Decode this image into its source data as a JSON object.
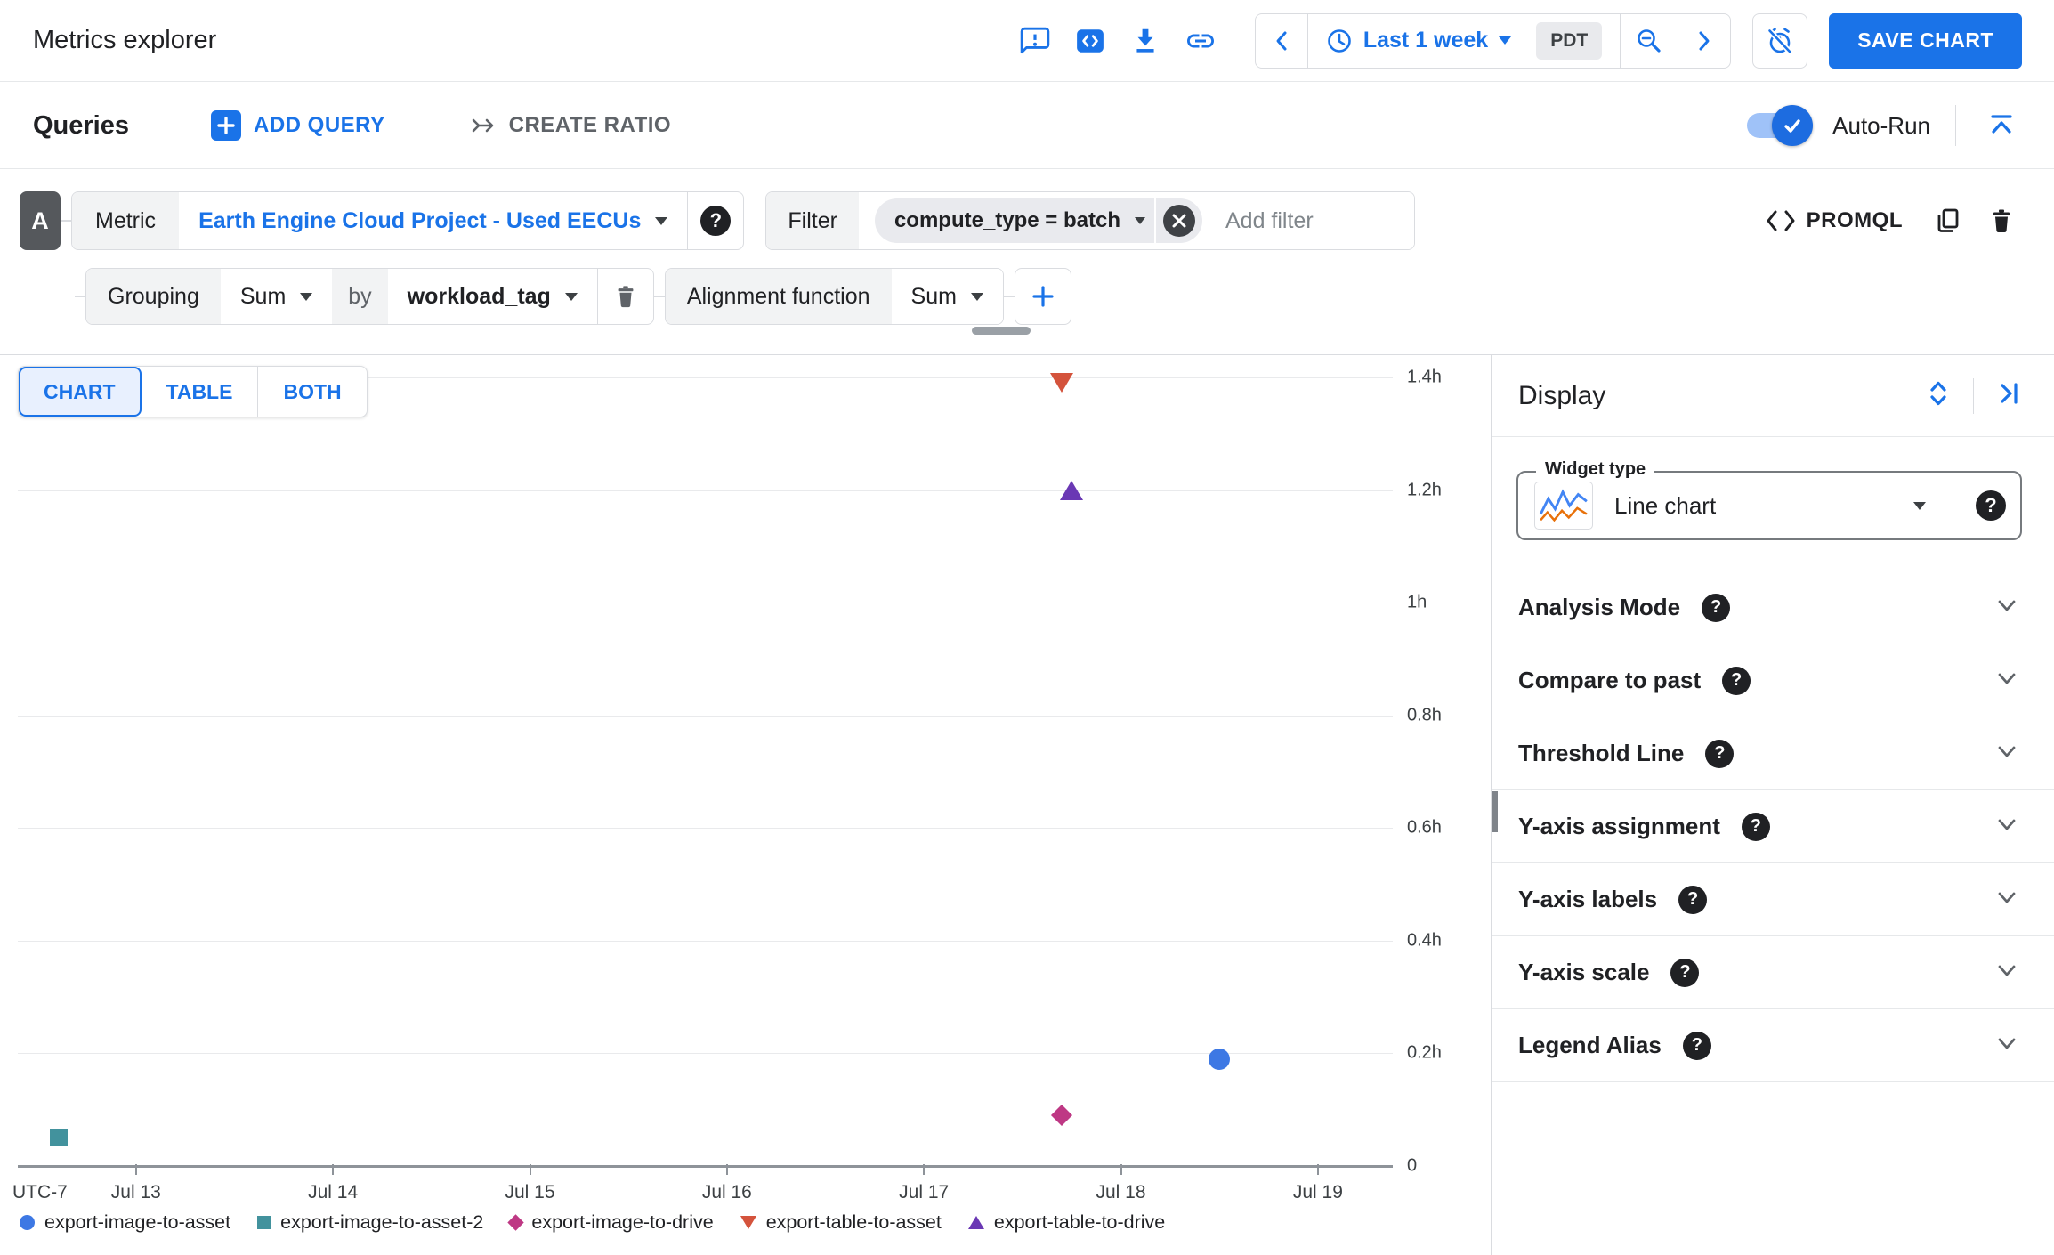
{
  "colors": {
    "accent": "#1a73e8",
    "axis": "#8e9399",
    "gridline": "#e9eaec"
  },
  "header": {
    "title": "Metrics explorer",
    "time_range_label": "Last 1 week",
    "timezone_badge": "PDT",
    "save_chart_label": "SAVE CHART"
  },
  "queries_bar": {
    "title": "Queries",
    "add_query_label": "ADD QUERY",
    "create_ratio_label": "CREATE RATIO",
    "auto_run_label": "Auto-Run",
    "auto_run_enabled": true
  },
  "query_builder": {
    "query_letter": "A",
    "metric_label": "Metric",
    "metric_value": "Earth Engine Cloud Project - Used EECUs",
    "filter_label": "Filter",
    "filter_chip": "compute_type = batch",
    "add_filter_placeholder": "Add filter",
    "promql_label": "PROMQL",
    "grouping_label": "Grouping",
    "grouping_value": "Sum",
    "by_label": "by",
    "by_value": "workload_tag",
    "alignment_label": "Alignment function",
    "alignment_value": "Sum"
  },
  "view_tabs": [
    {
      "label": "CHART",
      "selected": true
    },
    {
      "label": "TABLE",
      "selected": false
    },
    {
      "label": "BOTH",
      "selected": false
    }
  ],
  "chart_data": {
    "type": "scatter",
    "title": "",
    "grid": true,
    "legend_position": "bottom",
    "x_axis": {
      "corner_label": "UTC-7",
      "span_days": 6.98,
      "ticks": [
        {
          "label": "Jul 13",
          "day_offset": 0.6
        },
        {
          "label": "Jul 14",
          "day_offset": 1.6
        },
        {
          "label": "Jul 15",
          "day_offset": 2.6
        },
        {
          "label": "Jul 16",
          "day_offset": 3.6
        },
        {
          "label": "Jul 17",
          "day_offset": 4.6
        },
        {
          "label": "Jul 18",
          "day_offset": 5.6
        },
        {
          "label": "Jul 19",
          "day_offset": 6.6
        }
      ]
    },
    "y_axis": {
      "side": "right",
      "unit": "hours",
      "min_hours": 0,
      "max_hours": 1.4,
      "ticks": [
        {
          "label": "1.4h",
          "hours": 1.4
        },
        {
          "label": "1.2h",
          "hours": 1.2
        },
        {
          "label": "1h",
          "hours": 1.0
        },
        {
          "label": "0.8h",
          "hours": 0.8
        },
        {
          "label": "0.6h",
          "hours": 0.6
        },
        {
          "label": "0.4h",
          "hours": 0.4
        },
        {
          "label": "0.2h",
          "hours": 0.2
        },
        {
          "label": "0",
          "hours": 0
        }
      ]
    },
    "series": [
      {
        "name": "export-image-to-asset",
        "marker": "circle",
        "color": "#3D78E4",
        "points": [
          {
            "approx_x": "Jul 18 ~12:00",
            "day_offset": 6.1,
            "hours": 0.19
          }
        ]
      },
      {
        "name": "export-image-to-asset-2",
        "marker": "square",
        "color": "#42929D",
        "points": [
          {
            "approx_x": "Jul 12 ~15:00",
            "day_offset": 0.21,
            "hours": 0.05
          }
        ]
      },
      {
        "name": "export-image-to-drive",
        "marker": "diamond",
        "color": "#BE3884",
        "points": [
          {
            "approx_x": "Jul 17 ~17:00",
            "day_offset": 5.3,
            "hours": 0.09
          }
        ]
      },
      {
        "name": "export-table-to-asset",
        "marker": "triangle-down",
        "color": "#D4533C",
        "points": [
          {
            "approx_x": "Jul 17 ~17:00",
            "day_offset": 5.3,
            "hours": 1.39
          }
        ]
      },
      {
        "name": "export-table-to-drive",
        "marker": "triangle-up",
        "color": "#6A38B4",
        "points": [
          {
            "approx_x": "Jul 17 ~18:00",
            "day_offset": 5.35,
            "hours": 1.2
          }
        ]
      }
    ]
  },
  "display_panel": {
    "title": "Display",
    "widget_type_label": "Widget type",
    "widget_type_value": "Line chart",
    "sections": [
      {
        "label": "Analysis Mode"
      },
      {
        "label": "Compare to past"
      },
      {
        "label": "Threshold Line"
      },
      {
        "label": "Y-axis assignment"
      },
      {
        "label": "Y-axis labels"
      },
      {
        "label": "Y-axis scale"
      },
      {
        "label": "Legend Alias"
      }
    ]
  }
}
